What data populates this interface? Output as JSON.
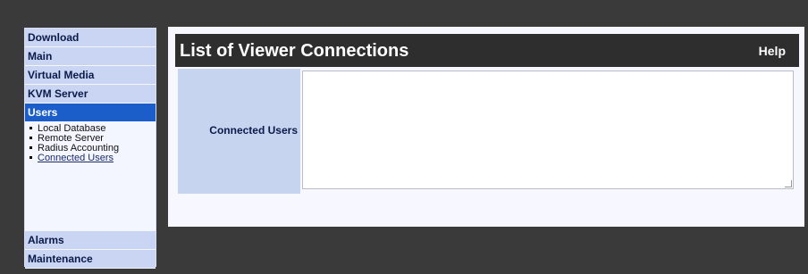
{
  "sidebar": {
    "items": [
      {
        "label": "Download"
      },
      {
        "label": "Main"
      },
      {
        "label": "Virtual Media"
      },
      {
        "label": "KVM Server"
      },
      {
        "label": "Users"
      }
    ],
    "users_subitems": [
      {
        "label": "Local Database"
      },
      {
        "label": "Remote Server"
      },
      {
        "label": "Radius Accounting"
      },
      {
        "label": "Connected Users"
      }
    ],
    "bottom_items": [
      {
        "label": "Alarms"
      },
      {
        "label": "Maintenance"
      }
    ]
  },
  "header": {
    "title": "List of Viewer Connections",
    "help_label": "Help"
  },
  "form": {
    "connected_users_label": "Connected Users",
    "connected_users_value": ""
  },
  "colors": {
    "background": "#3a3a3a",
    "nav_bg": "#c9d5f2",
    "nav_active": "#1b5ec9",
    "titlebar": "#2e2e2e"
  }
}
